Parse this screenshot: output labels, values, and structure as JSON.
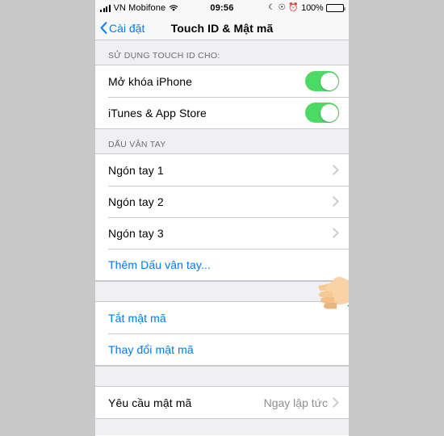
{
  "status_bar": {
    "signal_icon": "signal-bars-icon",
    "carrier": "VN Mobifone",
    "wifi_icon": "wifi-icon",
    "time": "09:56",
    "do_not_disturb_icon": "moon-icon",
    "rotation_lock_icon": "rotation-lock-icon",
    "alarm_icon": "alarm-clock-icon",
    "battery_percent": "100%",
    "battery_icon": "battery-full-icon"
  },
  "nav_bar": {
    "back_label": "Cài đặt",
    "back_icon": "chevron-left-icon",
    "title": "Touch ID & Mật mã"
  },
  "sections": {
    "touch_id_usage": {
      "header": "SỬ DỤNG TOUCH ID CHO:",
      "rows": [
        {
          "label": "Mở khóa iPhone",
          "toggle": "on"
        },
        {
          "label": "iTunes & App Store",
          "toggle": "on"
        }
      ]
    },
    "fingerprints": {
      "header": "DẤU VÂN TAY",
      "rows": [
        {
          "label": "Ngón tay 1",
          "accessory": "chevron-right-icon"
        },
        {
          "label": "Ngón tay 2",
          "accessory": "chevron-right-icon"
        },
        {
          "label": "Ngón tay 3",
          "accessory": "chevron-right-icon"
        },
        {
          "label": "Thêm Dấu vân tay...",
          "accessory": "none"
        }
      ]
    },
    "passcode": {
      "rows": [
        {
          "label": "Tắt mật mã"
        },
        {
          "label": "Thay đổi mật mã"
        }
      ]
    },
    "require_passcode": {
      "rows": [
        {
          "label": "Yêu cầu mật mã",
          "value": "Ngay lập tức",
          "accessory": "chevron-right-icon"
        }
      ]
    }
  },
  "annotation": {
    "pointer_icon": "pointing-hand-cursor",
    "skin_color": "#f7c994",
    "sleeve_color": "#0e8a72"
  },
  "colors": {
    "accent_blue": "#007aff",
    "toggle_on_green": "#4cd964",
    "list_background": "#efeff4",
    "separator": "#c9c9cb",
    "secondary_text": "#8e8e93",
    "frame_background": "#c8c8c8"
  }
}
